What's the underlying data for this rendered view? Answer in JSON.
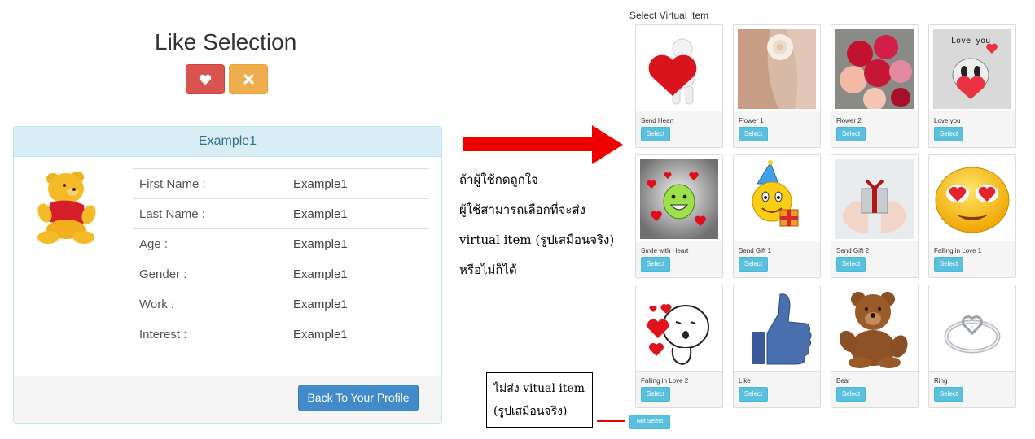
{
  "like_selection": {
    "title": "Like Selection",
    "like_icon": "heart-icon",
    "dislike_icon": "close-icon",
    "like_color": "#d9534f",
    "dislike_color": "#f0ad4e"
  },
  "profile": {
    "heading": "Example1",
    "fields": [
      {
        "label": "First Name :",
        "value": "Example1"
      },
      {
        "label": "Last Name :",
        "value": "Example1"
      },
      {
        "label": "Age :",
        "value": "Example1"
      },
      {
        "label": "Gender :",
        "value": "Example1"
      },
      {
        "label": "Work :",
        "value": "Example1"
      },
      {
        "label": "Interest :",
        "value": "Example1"
      }
    ],
    "back_button": "Back To Your Profile",
    "accent": "#428bca"
  },
  "annotation": {
    "lines": [
      "ถ้าผู้ใช้กดถูกใจ",
      "ผู้ใช้สามารถเลือกที่จะส่ง",
      "virtual item (รูปเสมือนจริง)",
      "หรือไม่ก็ได้"
    ],
    "box_lines": [
      "ไม่ส่ง vitual item",
      "(รูปเสมือนจริง)"
    ],
    "arrow_color": "#ee0000"
  },
  "virtual_items": {
    "title": "Select Virtual Item",
    "items": [
      {
        "name": "Send Heart",
        "select": "Select"
      },
      {
        "name": "Flower 1",
        "select": "Select"
      },
      {
        "name": "Flower 2",
        "select": "Select"
      },
      {
        "name": "Love you",
        "select": "Select",
        "image_text": "Love you"
      },
      {
        "name": "Smile with Heart",
        "select": "Select"
      },
      {
        "name": "Send Gift 1",
        "select": "Select"
      },
      {
        "name": "Send Gift 2",
        "select": "Select"
      },
      {
        "name": "Falling in Love 1",
        "select": "Select"
      },
      {
        "name": "Falling in Love 2",
        "select": "Select"
      },
      {
        "name": "Like",
        "select": "Select"
      },
      {
        "name": "Bear",
        "select": "Select"
      },
      {
        "name": "Ring",
        "select": "Select"
      }
    ],
    "not_select": "Not Select",
    "select_color": "#5bc0de"
  }
}
